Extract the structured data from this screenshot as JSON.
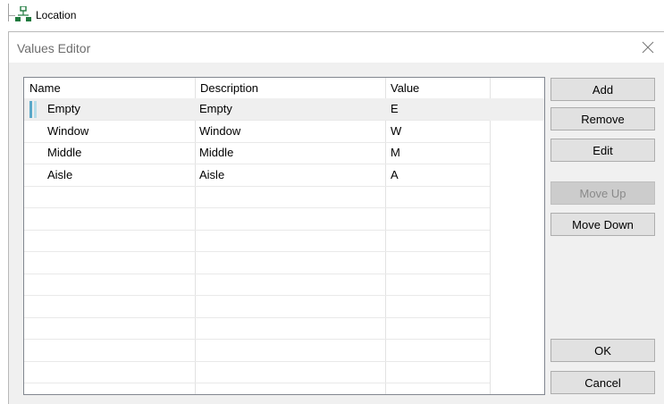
{
  "tree": {
    "label": "Location",
    "icon": "tree-node-icon"
  },
  "dialog": {
    "title": "Values Editor",
    "close_icon": "close-icon"
  },
  "grid": {
    "columns": [
      "Name",
      "Description",
      "Value"
    ],
    "rows": [
      {
        "name": "Empty",
        "description": "Empty",
        "value": "E",
        "selected": true
      },
      {
        "name": "Window",
        "description": "Window",
        "value": "W"
      },
      {
        "name": "Middle",
        "description": "Middle",
        "value": "M"
      },
      {
        "name": "Aisle",
        "description": "Aisle",
        "value": "A"
      }
    ]
  },
  "buttons": {
    "add": "Add",
    "remove": "Remove",
    "edit": "Edit",
    "move_up": "Move Up",
    "move_down": "Move Down",
    "ok": "OK",
    "cancel": "Cancel"
  }
}
